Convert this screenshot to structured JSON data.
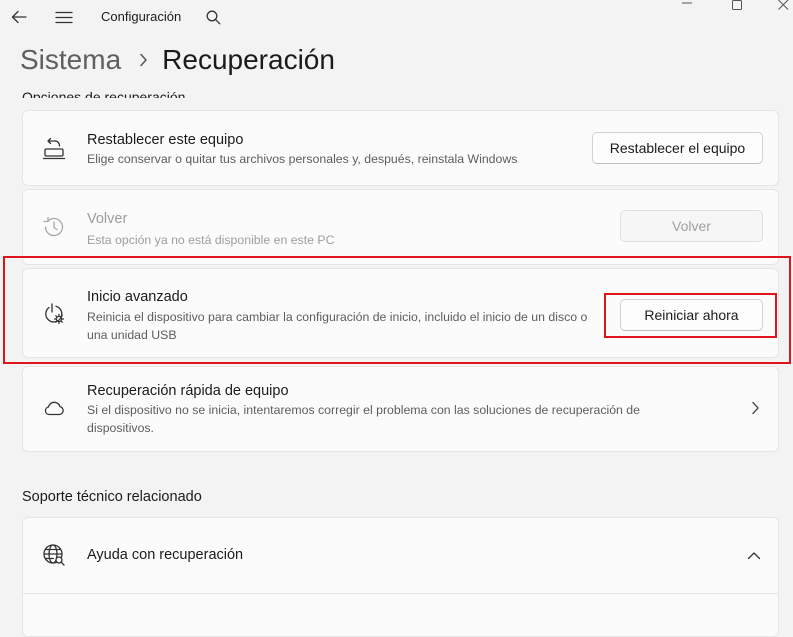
{
  "window": {
    "app_title": "Configuración",
    "back_icon": "back-arrow-icon",
    "menu_icon": "hamburger-menu-icon",
    "search_icon": "search-icon"
  },
  "breadcrumb": {
    "parent": "Sistema",
    "separator_icon": "chevron-right-icon",
    "current": "Recuperación"
  },
  "section_recovery": {
    "title": "Opciones de recuperación"
  },
  "recovery_options": [
    {
      "icon": "reset-pc-icon",
      "title": "Restablecer este equipo",
      "description": "Elige conservar o quitar tus archivos personales y, después, reinstala Windows",
      "button": "Restablecer el equipo",
      "enabled": true
    },
    {
      "icon": "history-icon",
      "title": "Volver",
      "description": "Esta opción ya no está disponible en este PC",
      "button": "Volver",
      "enabled": false
    },
    {
      "icon": "advanced-startup-icon",
      "title": "Inicio avanzado",
      "description": "Reinicia el dispositivo para cambiar la configuración de inicio, incluido el inicio de un disco o una unidad USB",
      "button": "Reiniciar ahora",
      "enabled": true,
      "highlighted": true
    },
    {
      "icon": "cloud-icon",
      "title": "Recuperación rápida de equipo",
      "description": "Si el dispositivo no se inicia, intentaremos corregir el problema con las soluciones de recuperación de dispositivos.",
      "action_icon": "chevron-right-icon",
      "enabled": true
    }
  ],
  "section_support": {
    "title": "Soporte técnico relacionado",
    "items": [
      {
        "icon": "globe-search-icon",
        "title": "Ayuda con recuperación",
        "action_icon": "chevron-up-icon"
      }
    ]
  },
  "colors": {
    "background": "#f3f3f3",
    "card": "#fbfbfb",
    "highlight_box": "#e0151b",
    "text_primary": "#1b1b1b",
    "text_secondary": "#5d5d5d",
    "text_disabled": "#9d9d9d"
  }
}
